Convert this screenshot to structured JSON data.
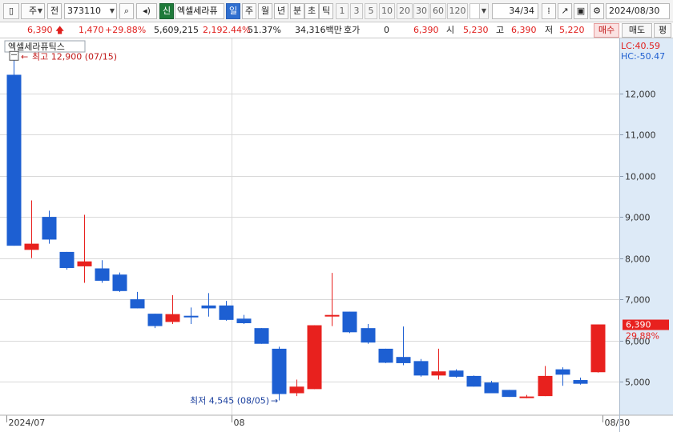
{
  "toolbar": {
    "period": "주",
    "type": "전",
    "code": "373110",
    "name": "엑셀세라퓨",
    "badge": "신",
    "intervals": [
      "일",
      "주",
      "월",
      "년",
      "분",
      "초",
      "틱"
    ],
    "active_interval": "일",
    "counts": [
      "1",
      "3",
      "5",
      "10",
      "20",
      "30",
      "60",
      "120"
    ],
    "page": "34",
    "page_total": "/34",
    "date": "2024/08/30"
  },
  "quote": {
    "price": "6,390",
    "change": "1,470",
    "change_pct": "+29.88%",
    "volume": "5,609,215",
    "volume_pct": "2,192.44%",
    "turnover_ratio": "51.37%",
    "amount": "34,316백만",
    "ask_label": "호가",
    "ask_value": "0",
    "ask_price": "6,390",
    "open_label": "시",
    "open": "5,230",
    "high_label": "고",
    "high": "6,390",
    "low_label": "저",
    "low": "5,220",
    "buy_label": "매수",
    "sell_label": "매도",
    "extra_label": "평"
  },
  "colors": {
    "up": "#e8211e",
    "down": "#1d5fd2",
    "axis_bg": "#ddeaf7"
  },
  "chart_data": {
    "type": "candlestick",
    "title": "엑셀세라퓨틱스",
    "indicator_lc": "LC:40.59",
    "indicator_hc": "HC:-50.47",
    "ylim": [
      4400,
      13100
    ],
    "y_ticks": [
      {
        "value": 5000,
        "label": "5,000"
      },
      {
        "value": 6000,
        "label": "6,000"
      },
      {
        "value": 7000,
        "label": "7,000"
      },
      {
        "value": 8000,
        "label": "8,000"
      },
      {
        "value": 9000,
        "label": "9,000"
      },
      {
        "value": 10000,
        "label": "10,000"
      },
      {
        "value": 11000,
        "label": "11,000"
      },
      {
        "value": 12000,
        "label": "12,000"
      }
    ],
    "x_labels": [
      {
        "index": 0,
        "label": "2024/07"
      },
      {
        "index": 12.75,
        "label": "08"
      },
      {
        "index": 33.7,
        "label": "08/30"
      }
    ],
    "high_note": "최고 12,900 (07/15)",
    "high_note_index": 0,
    "high_note_value": 12900,
    "low_note": "최저 4,545 (08/05)",
    "low_note_index": 15,
    "low_note_value": 4545,
    "last_price": 6390,
    "last_price_label": "6,390",
    "last_change_label": "29.88%",
    "candles": [
      {
        "o": 12450,
        "h": 12900,
        "l": 8300,
        "c": 8300
      },
      {
        "o": 8200,
        "h": 9400,
        "l": 8000,
        "c": 8350
      },
      {
        "o": 9000,
        "h": 9150,
        "l": 8350,
        "c": 8450
      },
      {
        "o": 8150,
        "h": 8150,
        "l": 7720,
        "c": 7760
      },
      {
        "o": 7800,
        "h": 9050,
        "l": 7400,
        "c": 7920
      },
      {
        "o": 7750,
        "h": 7950,
        "l": 7400,
        "c": 7450
      },
      {
        "o": 7600,
        "h": 7650,
        "l": 7180,
        "c": 7200
      },
      {
        "o": 7000,
        "h": 7180,
        "l": 6780,
        "c": 6780
      },
      {
        "o": 6650,
        "h": 6650,
        "l": 6300,
        "c": 6350
      },
      {
        "o": 6450,
        "h": 7100,
        "l": 6400,
        "c": 6640
      },
      {
        "o": 6600,
        "h": 6800,
        "l": 6400,
        "c": 6580
      },
      {
        "o": 6850,
        "h": 7150,
        "l": 6580,
        "c": 6780
      },
      {
        "o": 6850,
        "h": 6960,
        "l": 6480,
        "c": 6500
      },
      {
        "o": 6530,
        "h": 6620,
        "l": 6400,
        "c": 6420
      },
      {
        "o": 6300,
        "h": 6300,
        "l": 5920,
        "c": 5920
      },
      {
        "o": 5800,
        "h": 5850,
        "l": 4545,
        "c": 4700
      },
      {
        "o": 4720,
        "h": 5050,
        "l": 4650,
        "c": 4880
      },
      {
        "o": 4820,
        "h": 6370,
        "l": 4820,
        "c": 6370
      },
      {
        "o": 6590,
        "h": 7640,
        "l": 6350,
        "c": 6620
      },
      {
        "o": 6700,
        "h": 6700,
        "l": 6180,
        "c": 6200
      },
      {
        "o": 6300,
        "h": 6400,
        "l": 5920,
        "c": 5950
      },
      {
        "o": 5800,
        "h": 5800,
        "l": 5450,
        "c": 5460
      },
      {
        "o": 5600,
        "h": 6340,
        "l": 5400,
        "c": 5450
      },
      {
        "o": 5500,
        "h": 5550,
        "l": 5120,
        "c": 5150
      },
      {
        "o": 5150,
        "h": 5800,
        "l": 5050,
        "c": 5250
      },
      {
        "o": 5270,
        "h": 5300,
        "l": 5100,
        "c": 5120
      },
      {
        "o": 5140,
        "h": 5150,
        "l": 4880,
        "c": 4880
      },
      {
        "o": 4980,
        "h": 5020,
        "l": 4720,
        "c": 4720
      },
      {
        "o": 4800,
        "h": 4800,
        "l": 4630,
        "c": 4630
      },
      {
        "o": 4630,
        "h": 4680,
        "l": 4600,
        "c": 4640
      },
      {
        "o": 4650,
        "h": 5380,
        "l": 4650,
        "c": 5140
      },
      {
        "o": 5300,
        "h": 5350,
        "l": 4900,
        "c": 5170
      },
      {
        "o": 5040,
        "h": 5100,
        "l": 4930,
        "c": 4950
      },
      {
        "o": 5230,
        "h": 6390,
        "l": 5220,
        "c": 6390
      }
    ]
  }
}
